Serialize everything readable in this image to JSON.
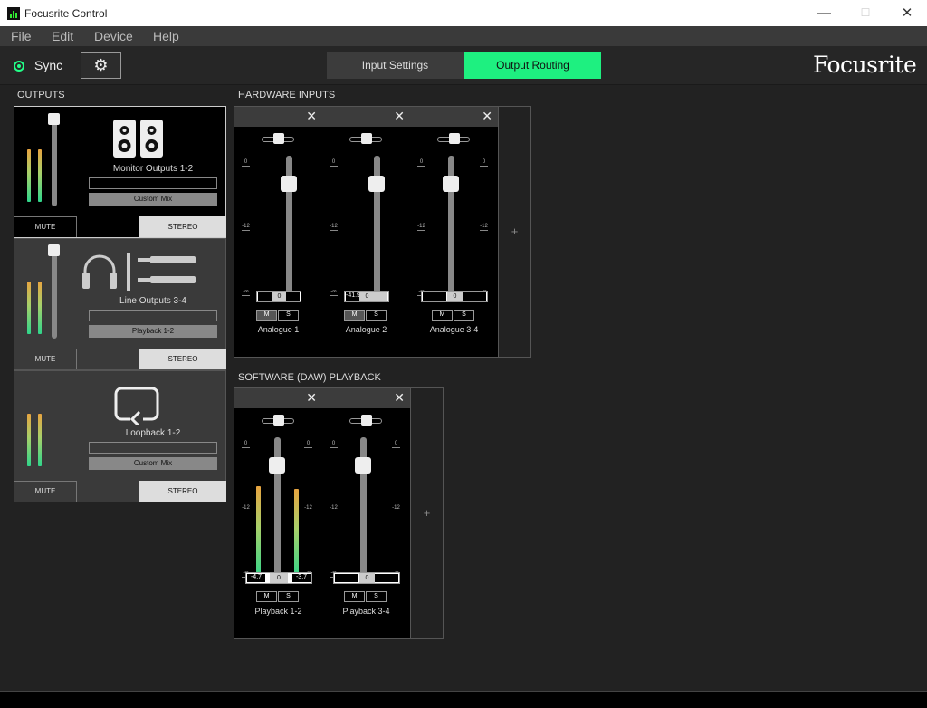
{
  "window": {
    "title": "Focusrite Control"
  },
  "menu": [
    "File",
    "Edit",
    "Device",
    "Help"
  ],
  "toolbar": {
    "sync_label": "Sync",
    "tabs": {
      "input": "Input Settings",
      "output": "Output Routing"
    },
    "logo": "Focusrite"
  },
  "colors": {
    "accent": "#1ef080",
    "meter_low": "#2fd58a",
    "meter_high": "#e8a440"
  },
  "outputs": {
    "title": "OUTPUTS",
    "items": [
      {
        "name": "Monitor Outputs 1-2",
        "source": "Custom Mix",
        "mute": "MUTE",
        "mode": "STEREO",
        "icon": "speakers-icon"
      },
      {
        "name": "Line Outputs 3-4",
        "source": "Playback 1-2",
        "mute": "MUTE",
        "mode": "STEREO",
        "icon": "headphones-icon"
      },
      {
        "name": "Loopback 1-2",
        "source": "Custom Mix",
        "mute": "MUTE",
        "mode": "STEREO",
        "icon": "loopback-icon"
      }
    ]
  },
  "hardware_inputs": {
    "title": "HARDWARE INPUTS",
    "scale": [
      "0",
      "-12",
      "-∞"
    ],
    "strips": [
      {
        "name": "Analogue 1",
        "left": "",
        "center": "0",
        "right": "",
        "mute": "M",
        "solo": "S"
      },
      {
        "name": "Analogue 2",
        "left": "-41.9",
        "center": "0",
        "right": "",
        "mute": "M",
        "solo": "S"
      },
      {
        "name": "Analogue 3-4",
        "left": "",
        "center": "0",
        "right": "",
        "mute": "M",
        "solo": "S"
      }
    ]
  },
  "software_playback": {
    "title": "SOFTWARE (DAW) PLAYBACK",
    "scale": [
      "0",
      "-12",
      "-∞"
    ],
    "strips": [
      {
        "name": "Playback 1-2",
        "left": "-4.7",
        "center": "0",
        "right": "-3.7",
        "mute": "M",
        "solo": "S"
      },
      {
        "name": "Playback 3-4",
        "left": "",
        "center": "0",
        "right": "",
        "mute": "M",
        "solo": "S"
      }
    ]
  },
  "close_glyph": "✕",
  "add_glyph": "+"
}
